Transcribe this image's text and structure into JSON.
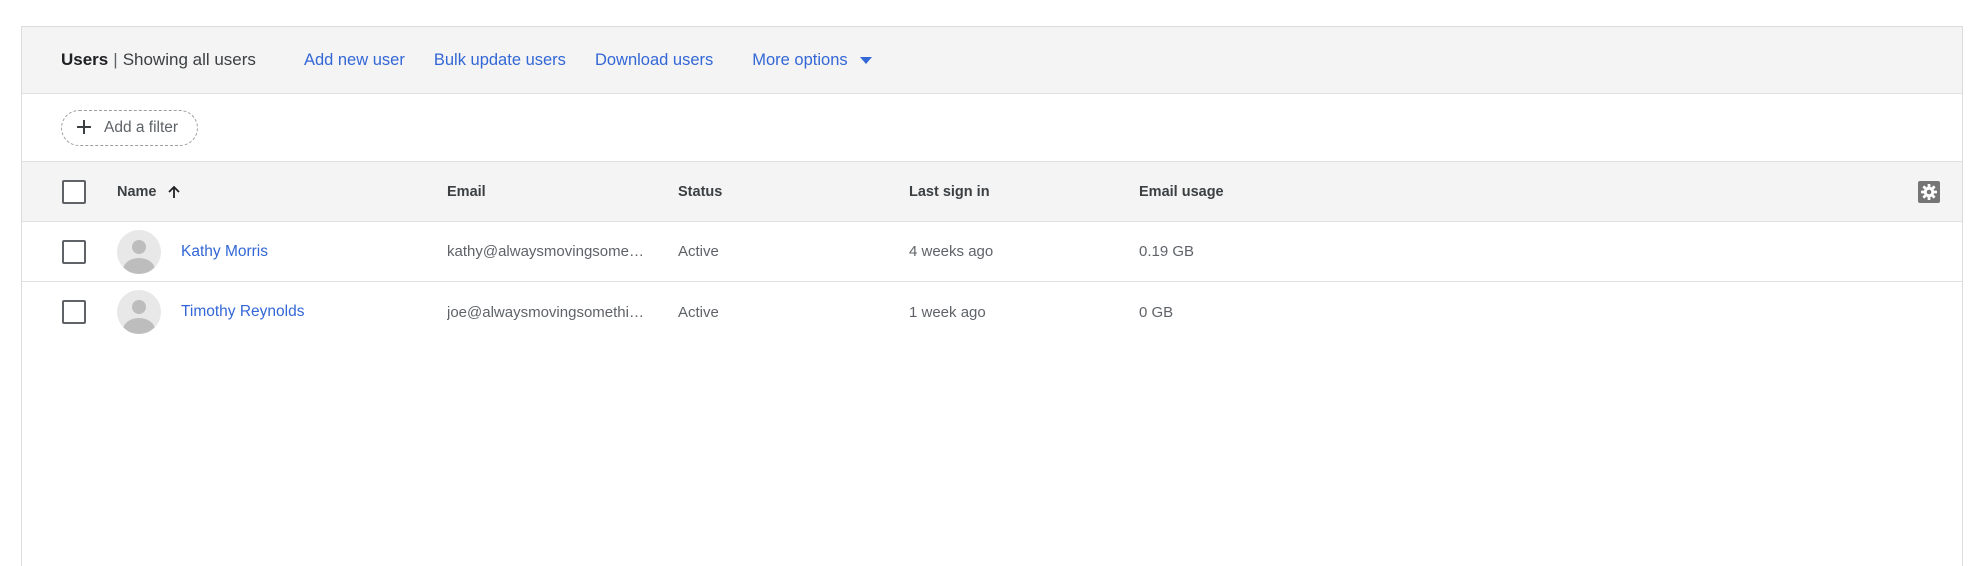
{
  "toolbar": {
    "title": "Users",
    "separator": "|",
    "subtitle": "Showing all users",
    "links": {
      "add_new_user": "Add new user",
      "bulk_update": "Bulk update users",
      "download": "Download users",
      "more_options": "More options"
    }
  },
  "filter": {
    "add_filter_label": "Add a filter"
  },
  "table": {
    "columns": {
      "name": "Name",
      "email": "Email",
      "status": "Status",
      "last_sign_in": "Last sign in",
      "email_usage": "Email usage"
    },
    "sort": {
      "column": "name",
      "direction": "ascending"
    },
    "rows": [
      {
        "name": "Kathy Morris",
        "email": "kathy@alwaysmovingsome…",
        "status": "Active",
        "last_sign_in": "4 weeks ago",
        "email_usage": "0.19 GB"
      },
      {
        "name": "Timothy Reynolds",
        "email": "joe@alwaysmovingsomethi…",
        "status": "Active",
        "last_sign_in": "1 week ago",
        "email_usage": "0 GB"
      }
    ]
  },
  "icons": {
    "plus": "plus-icon",
    "sort": "arrow-up-icon",
    "caret": "caret-down-icon",
    "settings": "gear-icon",
    "avatar": "default-avatar-icon"
  },
  "colors": {
    "link": "#3367d6",
    "header_bg": "#f4f4f4",
    "border": "#e0e0e0"
  }
}
